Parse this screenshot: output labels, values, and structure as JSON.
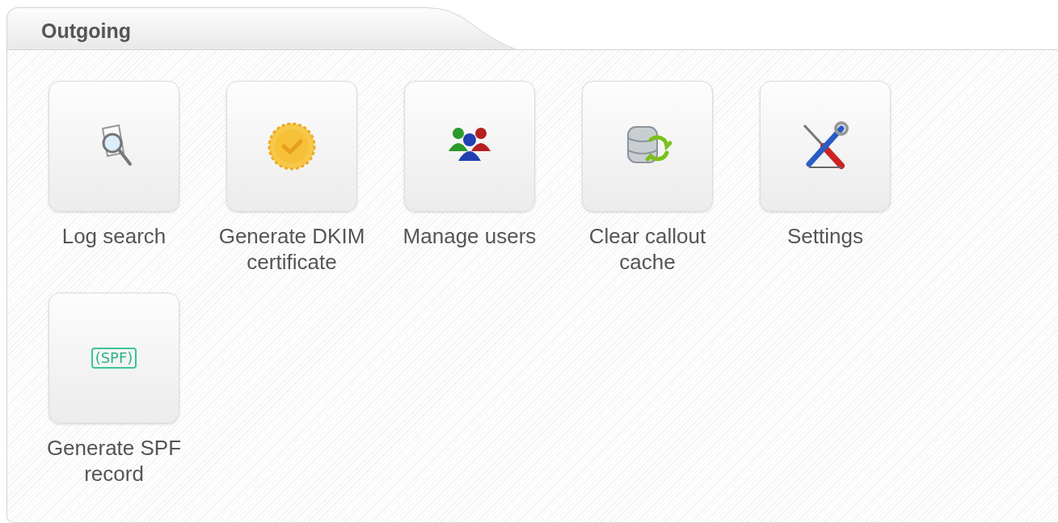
{
  "panel": {
    "title": "Outgoing"
  },
  "tiles": [
    {
      "kind": "log",
      "label": "Log search"
    },
    {
      "kind": "certificate",
      "label": "Generate DKIM certificate"
    },
    {
      "kind": "users",
      "label": "Manage users"
    },
    {
      "kind": "database",
      "label": "Clear callout cache"
    },
    {
      "kind": "tools",
      "label": "Settings"
    },
    {
      "kind": "spf",
      "label": "Generate SPF record",
      "icon_text": "(SPF)"
    }
  ]
}
